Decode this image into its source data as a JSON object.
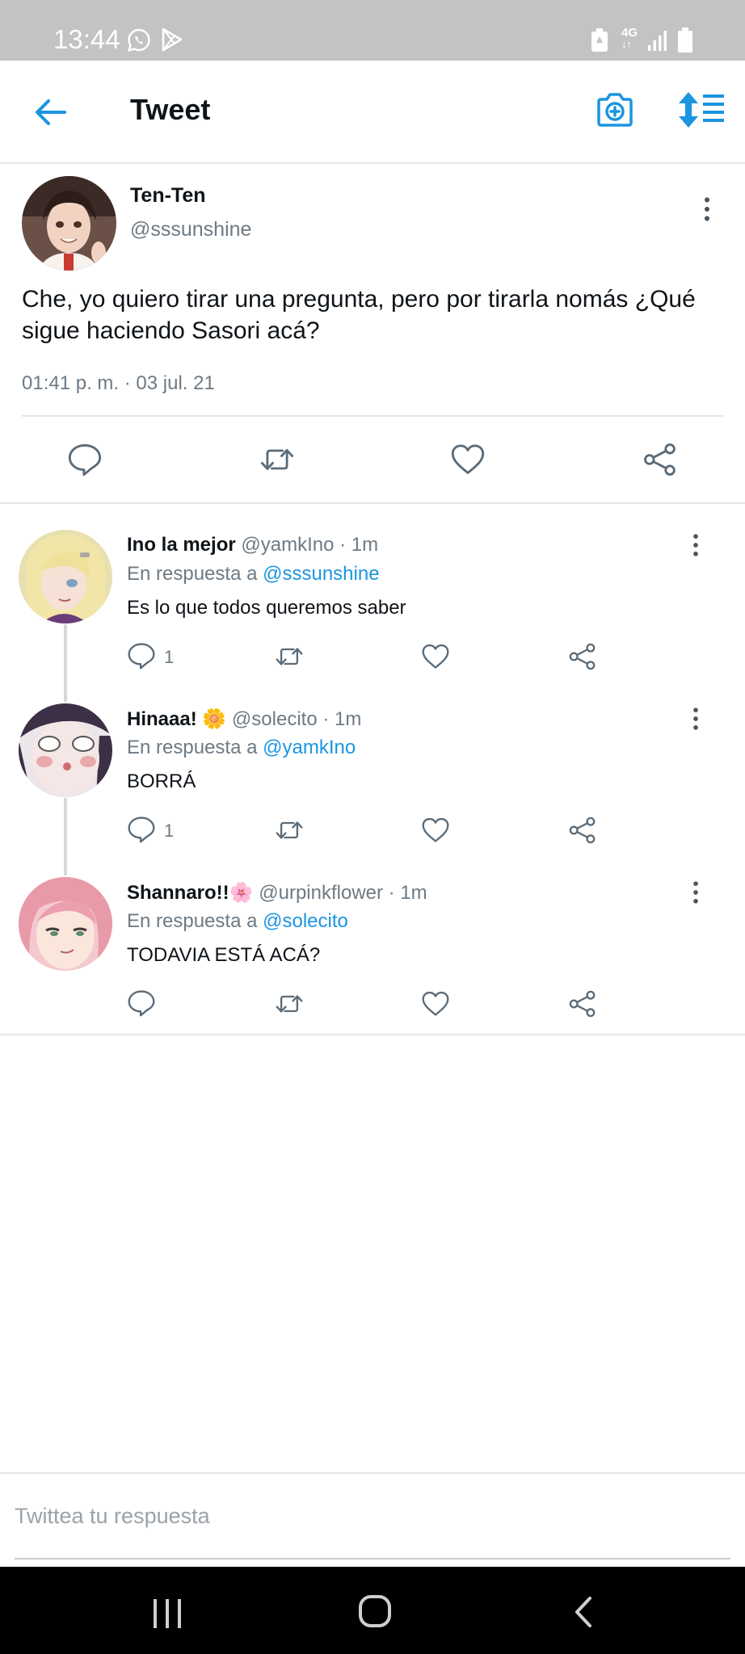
{
  "status_bar": {
    "time": "13:44",
    "network": "4G"
  },
  "header": {
    "title": "Tweet"
  },
  "main_tweet": {
    "name": "Ten-Ten",
    "handle": "@sssunshine",
    "text": "Che, yo quiero tirar una pregunta, pero por tirarla nomás ¿Qué sigue haciendo Sasori acá?",
    "timestamp": "01:41 p. m. · 03 jul. 21"
  },
  "replies": [
    {
      "name": "Ino la mejor",
      "meta": "@yamkIno · 1m",
      "reply_prefix": "En respuesta a ",
      "reply_to": "@sssunshine",
      "text": "Es lo que todos queremos saber",
      "reply_count": "1"
    },
    {
      "name": "Hinaaa! 🌼",
      "meta": "@solecito · 1m",
      "reply_prefix": "En respuesta a ",
      "reply_to": "@yamkIno",
      "text": "BORRÁ",
      "reply_count": "1"
    },
    {
      "name": "Shannaro!!🌸",
      "meta": "@urpinkflower · 1m",
      "reply_prefix": "En respuesta a ",
      "reply_to": "@solecito",
      "text": "TODAVIA ESTÁ ACÁ?",
      "reply_count": ""
    }
  ],
  "reply_box": {
    "placeholder": "Twittea tu respuesta"
  },
  "colors": {
    "accent": "#1b95e0",
    "icon_gray": "#5b6b78",
    "status_bar": "#c3c3c5"
  }
}
